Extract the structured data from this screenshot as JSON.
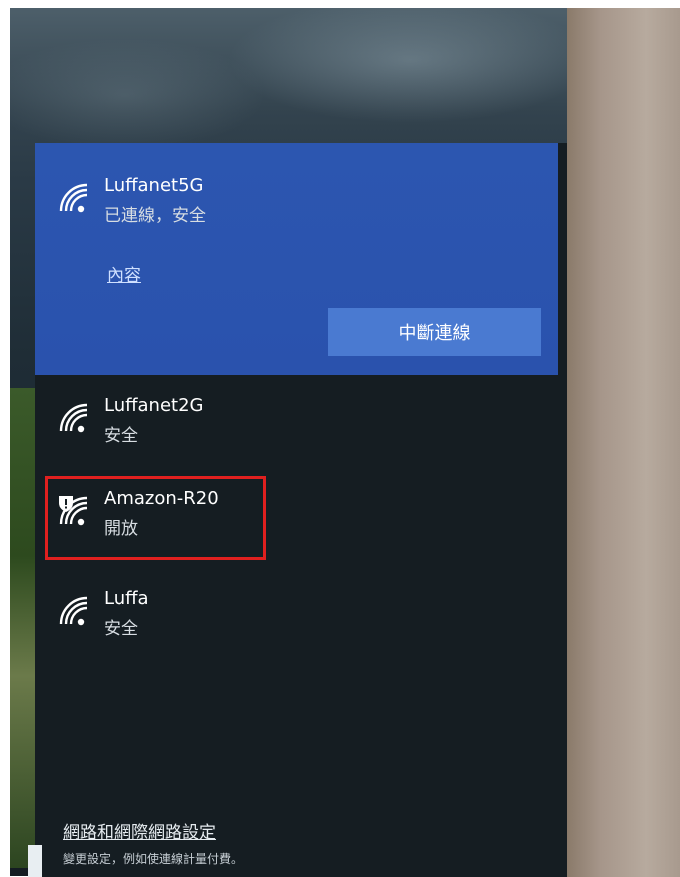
{
  "connected_network": {
    "name": "Luffanet5G",
    "status": "已連線，安全",
    "properties_link": "內容",
    "disconnect_button": "中斷連線",
    "icon": "wifi-icon"
  },
  "networks": [
    {
      "name": "Luffanet2G",
      "status": "安全",
      "icon": "wifi-icon"
    },
    {
      "name": "Amazon-R20",
      "status": "開放",
      "icon": "wifi-open-warning-icon",
      "highlighted": true
    },
    {
      "name": "Luffa",
      "status": "安全",
      "icon": "wifi-icon"
    }
  ],
  "footer": {
    "settings_link": "網路和網際網路設定",
    "settings_subtext": "變更設定，例如使連線計量付費。"
  },
  "colors": {
    "connected_bg": "#2a52ad",
    "button_bg": "#4a7ad1",
    "panel_bg": "#151d22",
    "highlight": "#e0201f"
  }
}
